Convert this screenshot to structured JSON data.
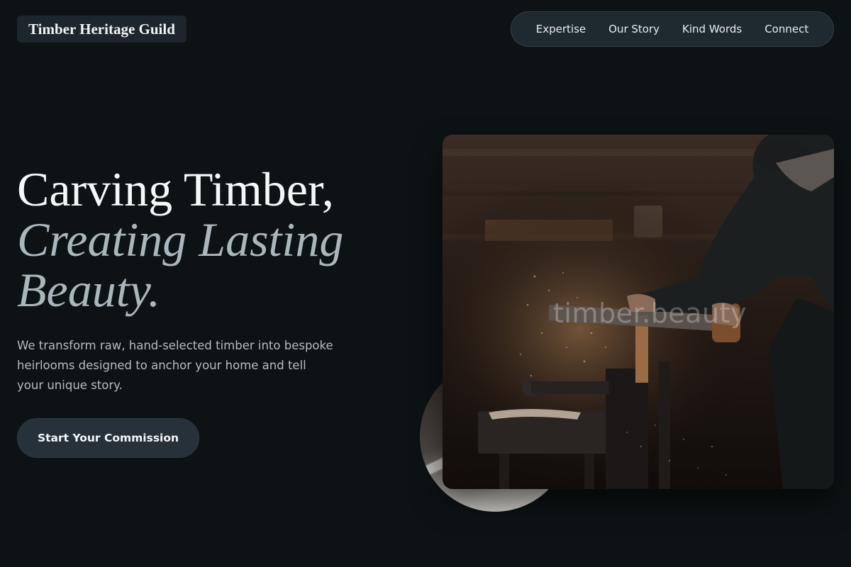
{
  "brand": {
    "name": "Timber Heritage Guild"
  },
  "nav": {
    "items": [
      "Expertise",
      "Our Story",
      "Kind Words",
      "Connect"
    ]
  },
  "hero": {
    "headline_line1": "Carving Timber,",
    "headline_line2": "Creating Lasting",
    "headline_line3": "Beauty.",
    "subtext": "We transform raw, hand-selected timber into bespoke heirlooms designed to anchor your home and tell your unique story.",
    "cta_label": "Start Your Commission",
    "image_watermark": "timber.beauty"
  },
  "colors": {
    "background": "#0d1214",
    "accent_muted": "#a9b7bd",
    "button_bg": "#263139",
    "nav_bg": "#1f2a30"
  }
}
